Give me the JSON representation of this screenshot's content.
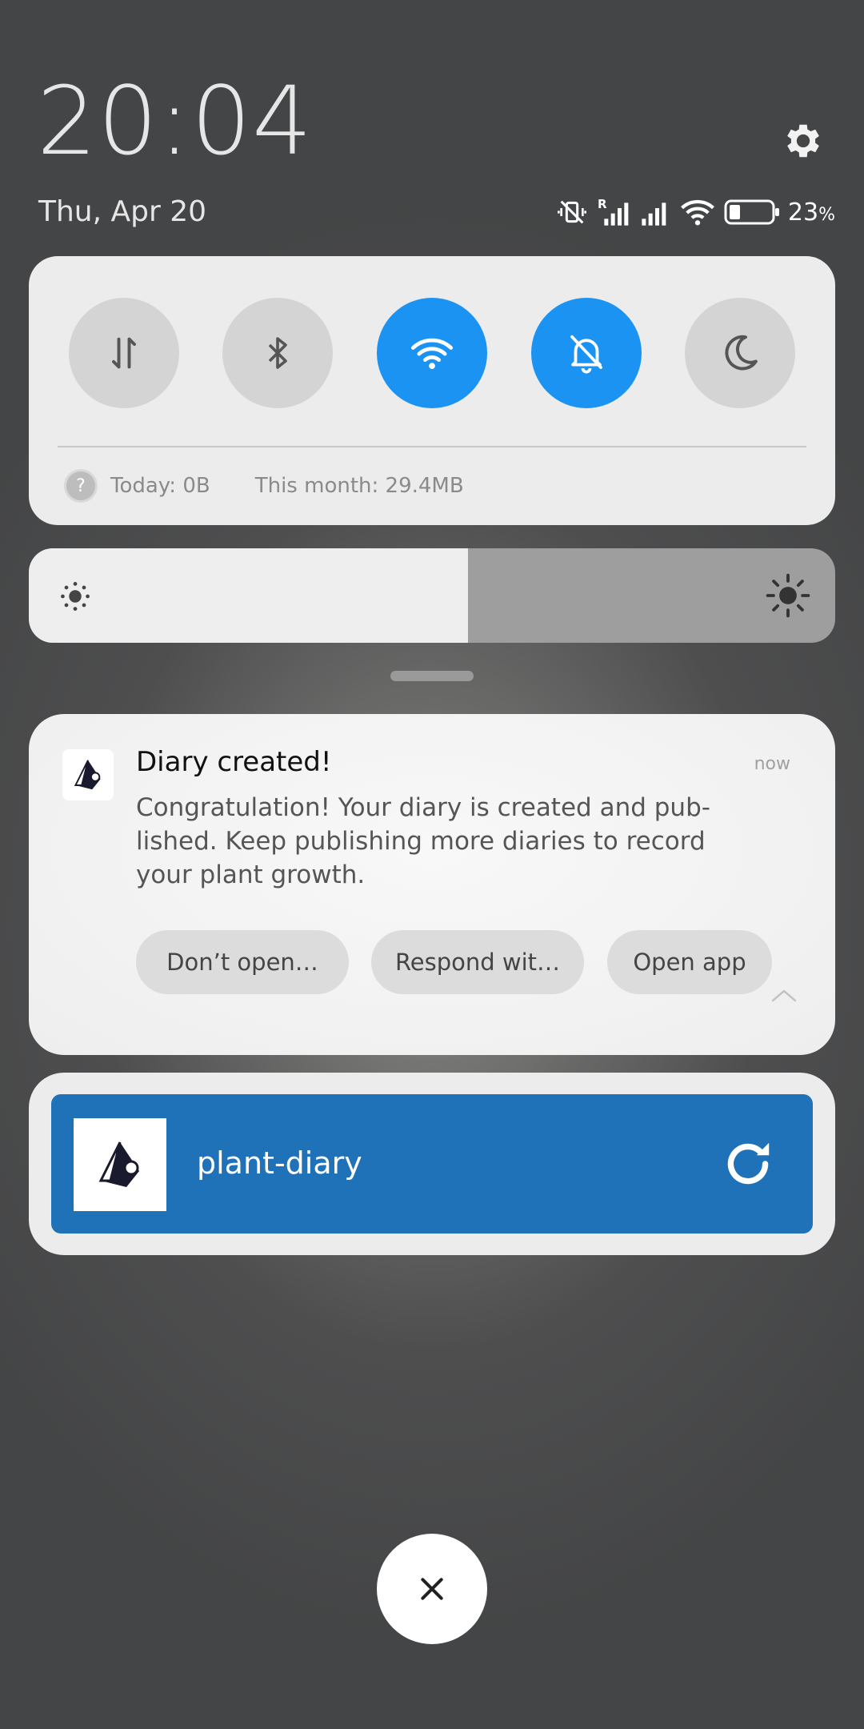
{
  "lockscreen": {
    "time": "20:04",
    "date": "Thu, Apr 20"
  },
  "status_bar": {
    "battery_percent": "23",
    "battery_unit": "%",
    "battery_level": 0.23,
    "signal_label": "R"
  },
  "quick_settings": {
    "toggles": [
      {
        "name": "mobile-data",
        "icon": "data-transfer-icon",
        "active": false
      },
      {
        "name": "bluetooth",
        "icon": "bluetooth-icon",
        "active": false
      },
      {
        "name": "wifi",
        "icon": "wifi-icon",
        "active": true
      },
      {
        "name": "mute",
        "icon": "bell-off-icon",
        "active": true
      },
      {
        "name": "dark-mode",
        "icon": "moon-icon",
        "active": false
      }
    ],
    "data_usage": {
      "today": "Today: 0B",
      "month": "This month: 29.4MB"
    },
    "active_color": "#1a93f2"
  },
  "brightness": {
    "level": 0.545
  },
  "notification": {
    "title": "Diary created!",
    "time": "now",
    "body": "Congratulation! Your diary is created and pub­lished. Keep publishing more diaries to record your plant growth.",
    "actions": [
      "Don’t open…",
      "Respond wit…",
      "Open app"
    ]
  },
  "media_notification": {
    "label": "plant-diary",
    "color": "#1f72b8"
  }
}
